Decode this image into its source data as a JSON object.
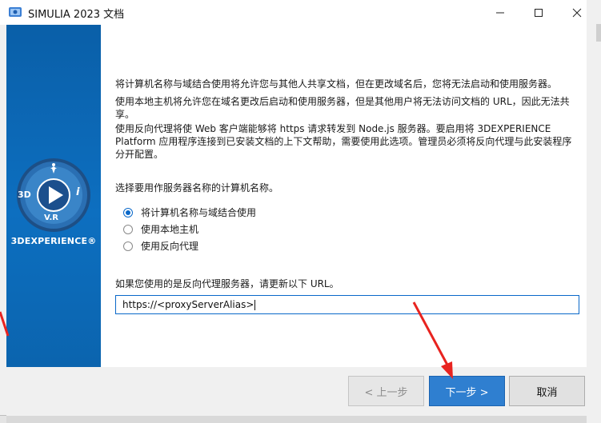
{
  "window": {
    "title": "SIMULIA 2023 文档",
    "controls": [
      "minimize-icon",
      "maximize-icon",
      "close-icon"
    ]
  },
  "sidebar": {
    "brand": "3DEXPERIENCE®",
    "logo": {
      "left": "3D",
      "right": "i",
      "bottom": "V.R",
      "top": "person-icon",
      "center": "play-icon"
    }
  },
  "content": {
    "description": [
      "将计算机名称与域结合使用将允许您与其他人共享文档，但在更改域名后，您将无法启动和使用服务器。",
      "使用本地主机将允许您在域名更改后启动和使用服务器，但是其他用户将无法访问文档的 URL，因此无法共享。",
      "使用反向代理将使 Web 客户端能够将 https 请求转发到 Node.js 服务器。要启用将 3DEXPERIENCE Platform 应用程序连接到已安装文档的上下文帮助，需要使用此选项。管理员必须将反向代理与此安装程序分开配置。"
    ],
    "question": "选择要用作服务器名称的计算机名称。",
    "options": [
      {
        "label": "将计算机名称与域结合使用",
        "selected": true
      },
      {
        "label": "使用本地主机",
        "selected": false
      },
      {
        "label": "使用反向代理",
        "selected": false
      }
    ],
    "url_prompt": "如果您使用的是反向代理服务器，请更新以下 URL。",
    "url_value": "https://<proxyServerAlias>"
  },
  "footer": {
    "back_label": "< 上一步",
    "next_label": "下一步 >",
    "cancel_label": "取消"
  },
  "colors": {
    "accent": "#0a68c9",
    "sidebar": "#0d6fc0",
    "annotation_arrow": "#e8231f"
  }
}
